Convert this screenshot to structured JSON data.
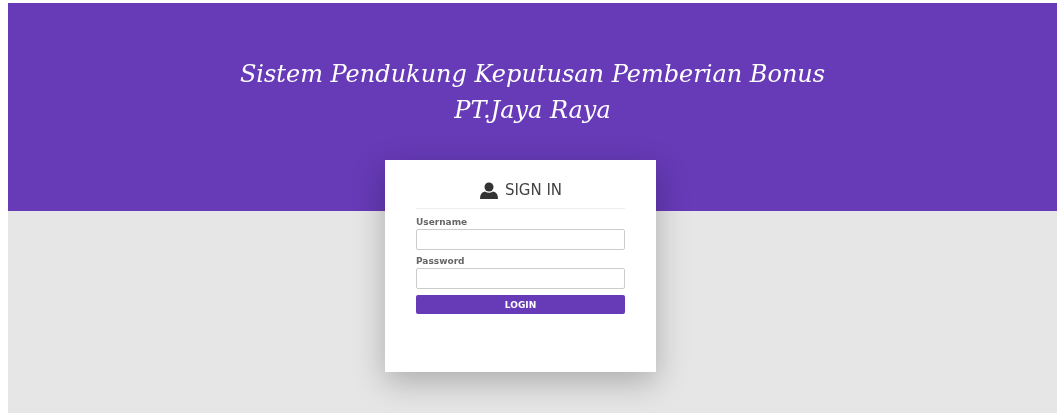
{
  "header": {
    "title_lines": [
      "Sistem Pendukung Keputusan Pemberian Bonus",
      "PT.Jaya Raya"
    ]
  },
  "login_card": {
    "heading": "SIGN IN",
    "fields": [
      {
        "label": "Username"
      },
      {
        "label": "Password"
      }
    ],
    "button": "LOGIN"
  }
}
